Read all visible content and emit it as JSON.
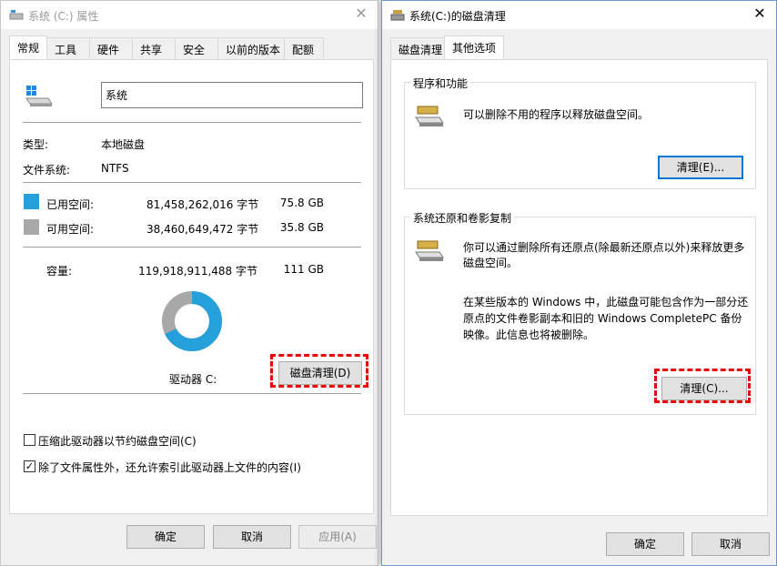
{
  "left_window": {
    "title": "系统 (C:) 属性",
    "tabs": [
      "常规",
      "工具",
      "硬件",
      "共享",
      "安全",
      "以前的版本",
      "配额"
    ],
    "drive_name_value": "系统",
    "type_label": "类型:",
    "type_value": "本地磁盘",
    "fs_label": "文件系统:",
    "fs_value": "NTFS",
    "used_label": "已用空间:",
    "used_bytes": "81,458,262,016 字节",
    "used_gb": "75.8 GB",
    "free_label": "可用空间:",
    "free_bytes": "38,460,649,472 字节",
    "free_gb": "35.8 GB",
    "capacity_label": "容量:",
    "capacity_bytes": "119,918,911,488 字节",
    "capacity_gb": "111 GB",
    "drive_label": "驱动器 C:",
    "disk_cleanup_button": "磁盘清理(D)",
    "compress_label": "压缩此驱动器以节约磁盘空间(C)",
    "compress_checked": false,
    "index_label": "除了文件属性外，还允许索引此驱动器上文件的内容(I)",
    "index_checked": true,
    "ok_button": "确定",
    "cancel_button": "取消",
    "apply_button": "应用(A)",
    "used_fraction": 0.679,
    "colors": {
      "used": "#26a0da",
      "free": "#a8a8a8"
    }
  },
  "right_window": {
    "title": "系统(C:)的磁盘清理",
    "tabs": [
      "磁盘清理",
      "其他选项"
    ],
    "programs_group_title": "程序和功能",
    "programs_text": "可以删除不用的程序以释放磁盘空间。",
    "programs_button": "清理(E)...",
    "restore_group_title": "系统还原和卷影复制",
    "restore_text_line1": "你可以通过删除所有还原点(除最新还原点以外)来释放更多",
    "restore_text_line2": "磁盘空间。",
    "restore_note_line1": "在某些版本的 Windows 中，此磁盘可能包含作为一部分还",
    "restore_note_line2": "原点的文件卷影副本和旧的 Windows CompletePC 备份",
    "restore_note_line3": "映像。此信息也将被删除。",
    "restore_button": "清理(C)...",
    "ok_button": "确定",
    "cancel_button": "取消"
  }
}
